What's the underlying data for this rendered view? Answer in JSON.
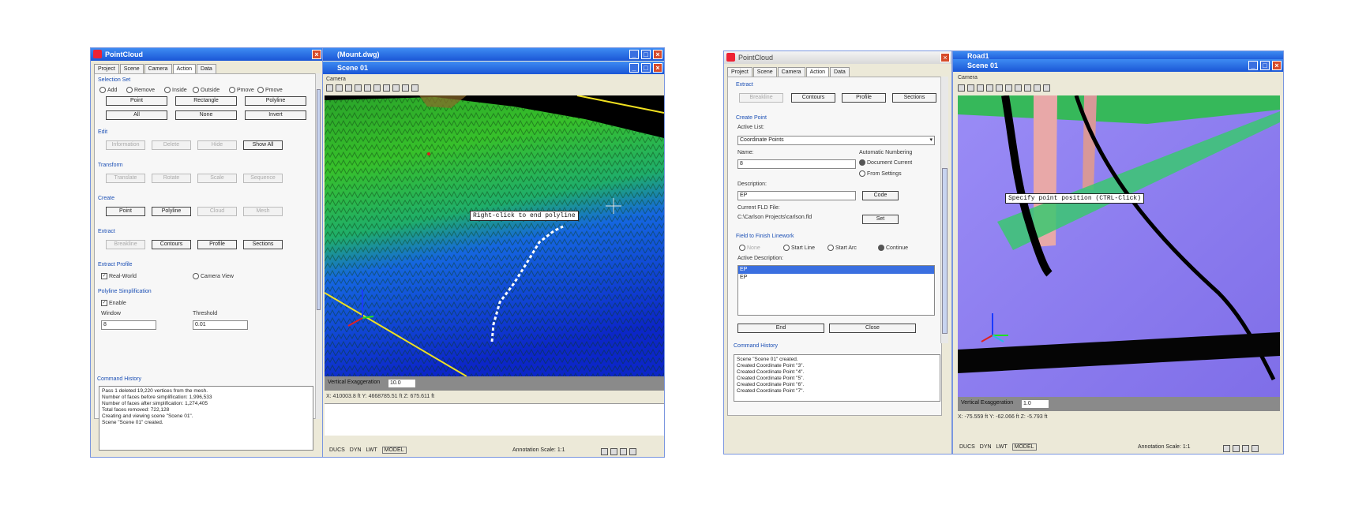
{
  "left": {
    "panel_title": "PointCloud",
    "tabs": [
      "Project",
      "Scene",
      "Camera",
      "Action",
      "Data"
    ],
    "selection": {
      "header": "Selection Set",
      "mode_options": [
        "Add",
        "Remove"
      ],
      "region_options": [
        "Inside",
        "Outside"
      ],
      "shape_options": [
        "Pmove",
        "Pmove"
      ],
      "buttons_row1": [
        "Point",
        "Rectangle",
        "Polyline"
      ],
      "buttons_row2": [
        "All",
        "None",
        "Invert"
      ]
    },
    "edit": {
      "header": "Edit",
      "buttons": [
        "Information",
        "Delete",
        "Hide",
        "Show All"
      ]
    },
    "transform": {
      "header": "Transform",
      "buttons": [
        "Translate",
        "Rotate",
        "Scale",
        "Sequence"
      ]
    },
    "create": {
      "header": "Create",
      "buttons": [
        "Point",
        "Polyline",
        "Cloud",
        "Mesh"
      ]
    },
    "extract": {
      "header": "Extract",
      "buttons": [
        "Breakline",
        "Contours",
        "Profile",
        "Sections"
      ]
    },
    "extract_profile": {
      "header": "Extract Profile",
      "real_world": "Real-World",
      "camera_view": "Camera View"
    },
    "simplification": {
      "header": "Polyline Simplification",
      "enable": "Enable",
      "window_label": "Window",
      "window_value": "8",
      "threshold_label": "Threshold",
      "threshold_value": "0.01"
    },
    "history": {
      "header": "Command History",
      "lines": [
        "Pass 1 deleted 19,220 vertices from the mesh.",
        "Number of faces before simplification: 1,996,533",
        "Number of faces after simplification: 1,274,405",
        "Total faces removed: 722,128",
        "Creating and viewing scene \"Scene 01\".",
        "Scene \"Scene 01\" created."
      ]
    },
    "viewer": {
      "file_title": "(Mount.dwg)",
      "scene_title": "Scene 01",
      "menu": "Camera",
      "tooltip": "Right-click to end polyline",
      "exaggeration_label": "Vertical Exaggeration",
      "exaggeration_value": "10.0",
      "coords": "X: 410003.8 ft  Y: 4668785.51 ft  Z: 675.611 ft",
      "status_items": [
        "DUCS",
        "DYN",
        "LWT",
        "MODEL"
      ],
      "annotation": "Annotation Scale: 1:1"
    }
  },
  "right": {
    "panel_title": "PointCloud",
    "tabs": [
      "Project",
      "Scene",
      "Camera",
      "Action",
      "Data"
    ],
    "extract": {
      "header": "Extract",
      "buttons": [
        "Breakline",
        "Contours",
        "Profile",
        "Sections"
      ]
    },
    "create_point": {
      "header": "Create Point",
      "active_list_label": "Active List:",
      "active_list_value": "Coordinate Points",
      "name_label": "Name:",
      "name_value": "8",
      "auto_numbering": "Automatic Numbering",
      "document_current": "Document Current",
      "from_settings": "From Settings",
      "description_label": "Description:",
      "description_value": "EP",
      "code_button": "Code",
      "fld_label": "Current FLD File:",
      "fld_value": "C:\\Carlson Projects\\carlson.fld",
      "set_button": "Set"
    },
    "field_to_finish": {
      "header": "Field to Finish Linework",
      "options": [
        "None",
        "Start Line",
        "Start Arc",
        "Continue"
      ],
      "active_description_label": "Active Description:",
      "descriptions": [
        "EP",
        "EP"
      ]
    },
    "end_button": "End",
    "close_button": "Close",
    "history": {
      "header": "Command History",
      "lines": [
        "Scene \"Scene 01\" created.",
        "Created Coordinate Point \"3\".",
        "Created Coordinate Point \"4\".",
        "Created Coordinate Point \"5\".",
        "Created Coordinate Point \"6\".",
        "Created Coordinate Point \"7\"."
      ]
    },
    "viewer": {
      "file_title": "Road1",
      "scene_title": "Scene 01",
      "menu": "Camera",
      "tooltip": "Specify point position (CTRL-Click)",
      "exaggeration_label": "Vertical Exaggeration",
      "exaggeration_value": "1.0",
      "coords": "X: -75.559 ft  Y: -62.066 ft  Z: -5.793 ft",
      "status_items": [
        "DUCS",
        "DYN",
        "LWT",
        "MODEL"
      ],
      "annotation": "Annotation Scale: 1:1"
    }
  },
  "colors": {
    "title_blue": "#1b56d6",
    "section_blue": "#1b4fb5",
    "terrain_green": "#35c02a",
    "terrain_blue": "#1638d8",
    "road_purple": "#8f7ef0"
  }
}
